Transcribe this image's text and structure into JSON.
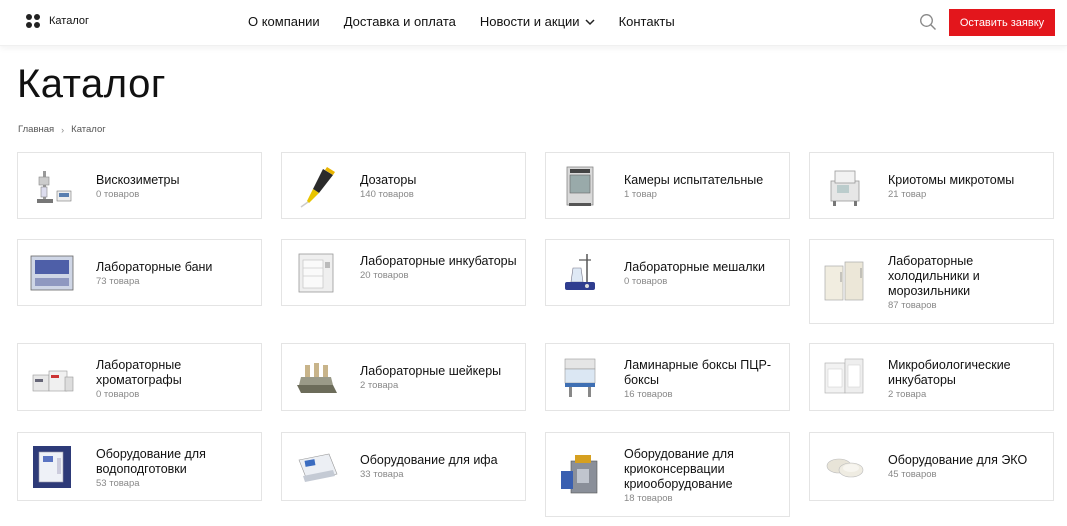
{
  "header": {
    "logo_label": "Каталог",
    "nav": [
      {
        "label": "О компании"
      },
      {
        "label": "Доставка и оплата"
      },
      {
        "label": "Новости и акции",
        "has_dropdown": true
      },
      {
        "label": "Контакты"
      }
    ],
    "search_icon": "search-icon",
    "cta_label": "Оставить заявку",
    "cta_color": "#e3161c"
  },
  "page": {
    "title": "Каталог",
    "breadcrumb": [
      {
        "label": "Главная"
      },
      {
        "label": "Каталог"
      }
    ]
  },
  "categories": [
    {
      "name": "Вискозиметры",
      "count": "0 товаров",
      "icon": "viscometer-image"
    },
    {
      "name": "Дозаторы",
      "count": "140 товаров",
      "icon": "pipette-image"
    },
    {
      "name": "Камеры испытательные",
      "count": "1 товар",
      "icon": "test-chamber-image"
    },
    {
      "name": "Криотомы микротомы",
      "count": "21 товар",
      "icon": "cryotome-image"
    },
    {
      "name": "Лабораторные бани",
      "count": "73 товара",
      "icon": "lab-bath-image"
    },
    {
      "name": "Лабораторные инкубаторы",
      "count": "20 товаров",
      "icon": "incubator-image"
    },
    {
      "name": "Лабораторные мешалки",
      "count": "0 товаров",
      "icon": "stirrer-image"
    },
    {
      "name": "Лабораторные холодильники и морозильники",
      "count": "87 товаров",
      "icon": "fridge-image"
    },
    {
      "name": "Лабораторные хроматографы",
      "count": "0 товаров",
      "icon": "chromatograph-image"
    },
    {
      "name": "Лабораторные шейкеры",
      "count": "2 товара",
      "icon": "shaker-image"
    },
    {
      "name": "Ламинарные боксы ПЦР-боксы",
      "count": "16 товаров",
      "icon": "laminar-box-image"
    },
    {
      "name": "Микробиологические инкубаторы",
      "count": "2 товара",
      "icon": "micro-incubator-image"
    },
    {
      "name": "Оборудование для водоподготовки",
      "count": "53 товара",
      "icon": "water-purifier-image"
    },
    {
      "name": "Оборудование для ифа",
      "count": "33 товара",
      "icon": "elisa-reader-image"
    },
    {
      "name": "Оборудование для криоконсервации криооборудование",
      "count": "18 товаров",
      "icon": "cryo-equipment-image"
    },
    {
      "name": "Оборудование для ЭКО",
      "count": "45 товаров",
      "icon": "ivf-equipment-image"
    }
  ]
}
